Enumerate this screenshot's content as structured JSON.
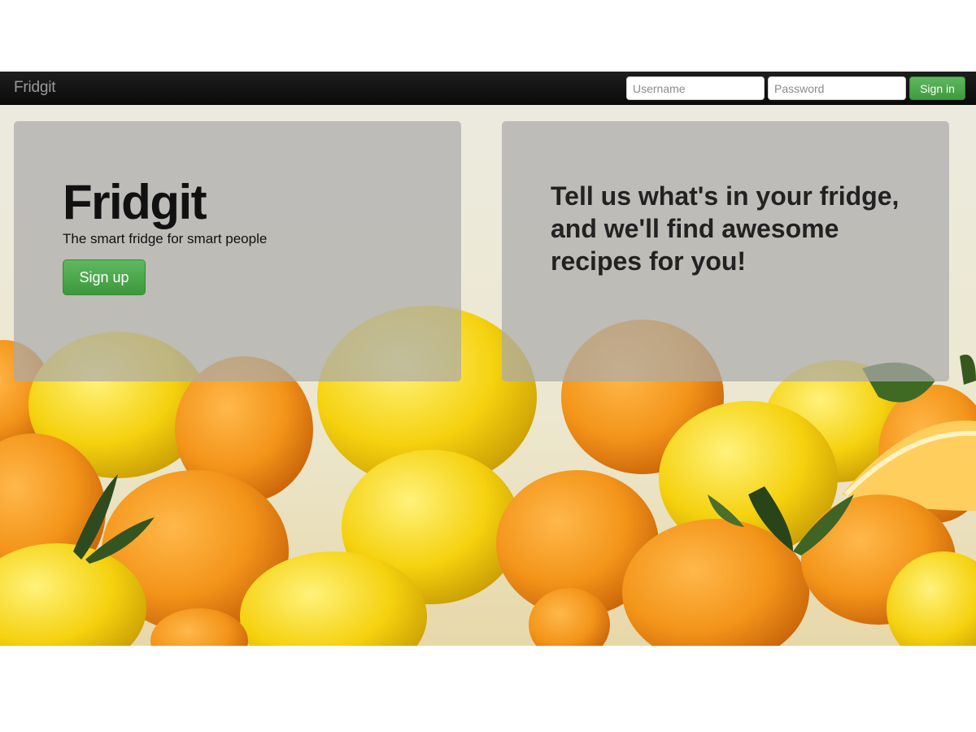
{
  "navbar": {
    "brand": "Fridgit",
    "username_placeholder": "Username",
    "password_placeholder": "Password",
    "signin_label": "Sign in"
  },
  "hero": {
    "title": "Fridgit",
    "tagline": "The smart fridge for smart people",
    "signup_label": "Sign up",
    "pitch": "Tell us what's in your fridge, and we'll find awesome recipes for you!"
  },
  "colors": {
    "navbar": "#111111",
    "button_green": "#4aa84a",
    "panel_overlay": "#aaaaaa"
  },
  "background": {
    "description_icon": "oranges-lemons-photo"
  }
}
